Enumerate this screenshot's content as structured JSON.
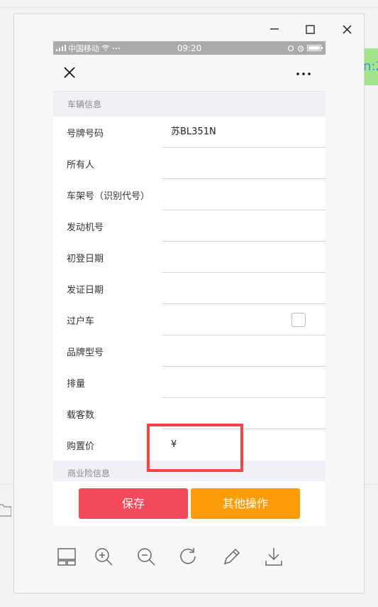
{
  "background": {
    "green_strip_text": "n:2"
  },
  "window": {
    "minimize_symbol": "—",
    "maximize_symbol": "☐",
    "close_symbol": "✕"
  },
  "phone": {
    "status": {
      "carrier": "中国移动",
      "time": "09:20"
    },
    "section_vehicle": "车辆信息",
    "fields": [
      {
        "label": "号牌号码",
        "value": "苏BL351N"
      },
      {
        "label": "所有人",
        "value": ""
      },
      {
        "label": "车架号（识别代号）",
        "value": ""
      },
      {
        "label": "发动机号",
        "value": ""
      },
      {
        "label": "初登日期",
        "value": ""
      },
      {
        "label": "发证日期",
        "value": ""
      },
      {
        "label": "过户车",
        "value": ""
      },
      {
        "label": "品牌型号",
        "value": ""
      },
      {
        "label": "排量",
        "value": ""
      },
      {
        "label": "载客数",
        "value": ""
      },
      {
        "label": "购置价",
        "value": "¥"
      }
    ],
    "section_commercial": "商业险信息",
    "buttons": {
      "save": "保存",
      "other": "其他操作"
    }
  },
  "colors": {
    "save_button": "#f24a5b",
    "other_button": "#fb9d0a",
    "highlight_box": "#f24545"
  },
  "toolbar_icons": [
    "layout-icon",
    "zoom-in-icon",
    "zoom-out-icon",
    "rotate-icon",
    "edit-icon",
    "download-icon"
  ]
}
